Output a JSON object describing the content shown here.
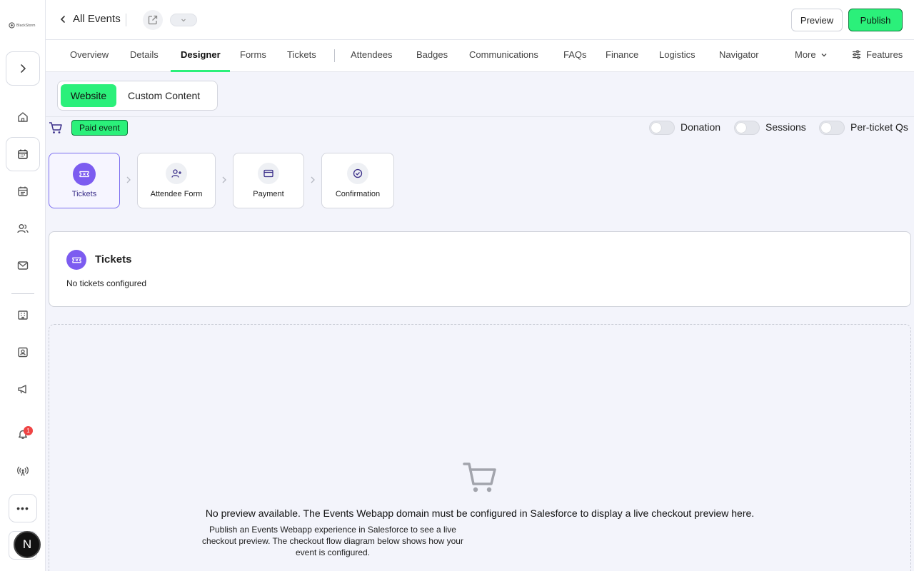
{
  "rail": {
    "logo_text": "BlackStorm",
    "notification_count": "1",
    "more_label": "•••",
    "avatar_initial": "N"
  },
  "topbar": {
    "back_label": "All Events",
    "preview_label": "Preview",
    "publish_label": "Publish"
  },
  "tabs": {
    "items": [
      "Overview",
      "Details",
      "Designer",
      "Forms",
      "Tickets",
      "Attendees",
      "Badges",
      "Communications",
      "FAQs",
      "Finance",
      "Logistics",
      "Navigator"
    ],
    "active": "Designer",
    "more_label": "More",
    "features_label": "Features"
  },
  "segment": {
    "active_label": "Website",
    "other_label": "Custom Content"
  },
  "status": {
    "badge_label": "Paid event",
    "toggles": [
      {
        "label": "Donation",
        "on": false
      },
      {
        "label": "Sessions",
        "on": false
      },
      {
        "label": "Per-ticket Qs",
        "on": false
      }
    ]
  },
  "steps": [
    {
      "label": "Tickets",
      "icon": "ticket-icon",
      "active": true
    },
    {
      "label": "Attendee Form",
      "icon": "user-plus-icon",
      "active": false
    },
    {
      "label": "Payment",
      "icon": "credit-card-icon",
      "active": false
    },
    {
      "label": "Confirmation",
      "icon": "check-circle-icon",
      "active": false
    }
  ],
  "tickets_card": {
    "title": "Tickets",
    "empty_text": "No tickets configured"
  },
  "preview": {
    "title": "No preview available. The Events Webapp domain must be configured in Salesforce to display a live checkout preview here.",
    "description": "Publish an Events Webapp experience in Salesforce to see a live checkout preview. The checkout flow diagram below shows how your event is configured."
  },
  "colors": {
    "accent_green": "#2bf07a",
    "accent_purple": "#7c5cf0"
  }
}
